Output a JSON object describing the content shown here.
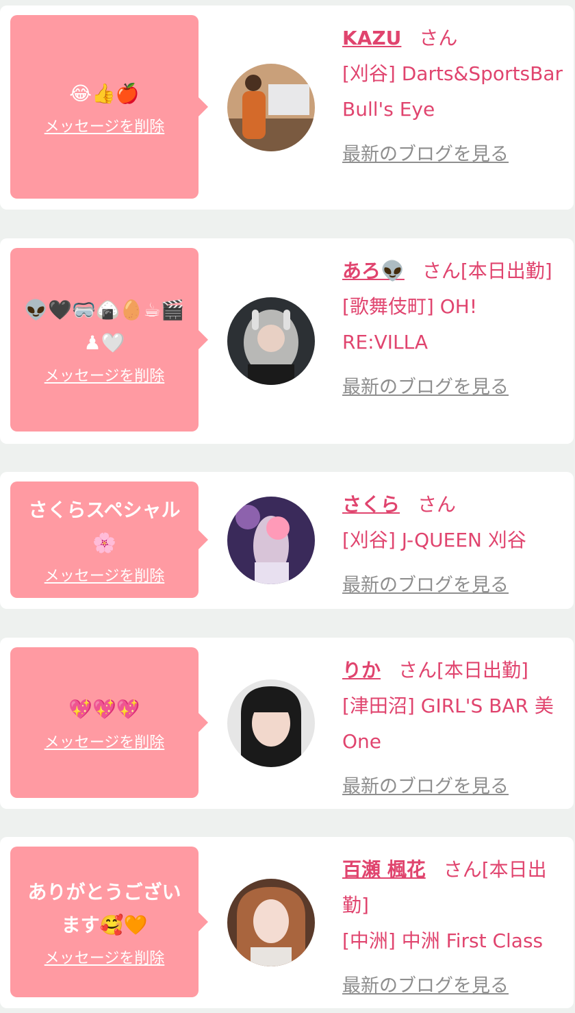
{
  "cards": [
    {
      "message": "😂👍🍎",
      "delete_label": "メッセージを削除",
      "name": "KAZU",
      "suffix": "さん",
      "shop": "[刈谷] Darts&SportsBar Bull's Eye",
      "blog_label": "最新のブログを見る"
    },
    {
      "message": "👽🖤🥽🍙🥚☕🎬♟🤍",
      "delete_label": "メッセージを削除",
      "name": "あろ👽",
      "suffix": "さん[本日出勤]",
      "shop": "[歌舞伎町] OH! RE:VILLA",
      "blog_label": "最新のブログを見る"
    },
    {
      "message": "さくらスペシャル🌸",
      "delete_label": "メッセージを削除",
      "name": "さくら",
      "suffix": "さん",
      "shop": "[刈谷] J-QUEEN 刈谷",
      "blog_label": "最新のブログを見る"
    },
    {
      "message": "💖💖💖",
      "delete_label": "メッセージを削除",
      "name": "りか",
      "suffix": "さん[本日出勤]",
      "shop": "[津田沼] GIRL'S BAR 美One",
      "blog_label": "最新のブログを見る"
    },
    {
      "message": "ありがとうございます🥰🧡",
      "delete_label": "メッセージを削除",
      "name": "百瀬 楓花",
      "suffix": "さん[本日出勤]",
      "shop": "[中洲] 中洲 First Class",
      "blog_label": "最新のブログを見る"
    }
  ]
}
